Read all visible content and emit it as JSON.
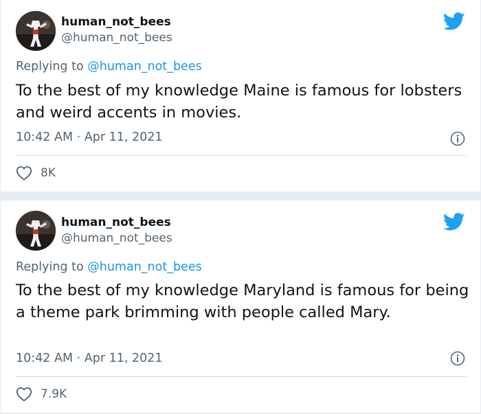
{
  "tweets": [
    {
      "display_name": "human_not_bees",
      "handle": "@human_not_bees",
      "replying_prefix": "Replying to ",
      "replying_to": "@human_not_bees",
      "text": "To the best of my knowledge Maine is famous for lobsters and weird accents in movies.",
      "timestamp": "10:42 AM · Apr 11, 2021",
      "likes": "8K"
    },
    {
      "display_name": "human_not_bees",
      "handle": "@human_not_bees",
      "replying_prefix": "Replying to ",
      "replying_to": "@human_not_bees",
      "text": "To the best of my knowledge Maryland is famous for being a theme park brimming with people called Mary.",
      "timestamp": "10:42 AM · Apr 11, 2021",
      "likes": "7.9K"
    }
  ],
  "colors": {
    "brand": "#1da1f2",
    "link": "#1b95e0",
    "secondary_text": "#536471"
  },
  "icons": {
    "brand": "twitter-bird-icon",
    "info": "info-icon",
    "like": "heart-icon"
  }
}
